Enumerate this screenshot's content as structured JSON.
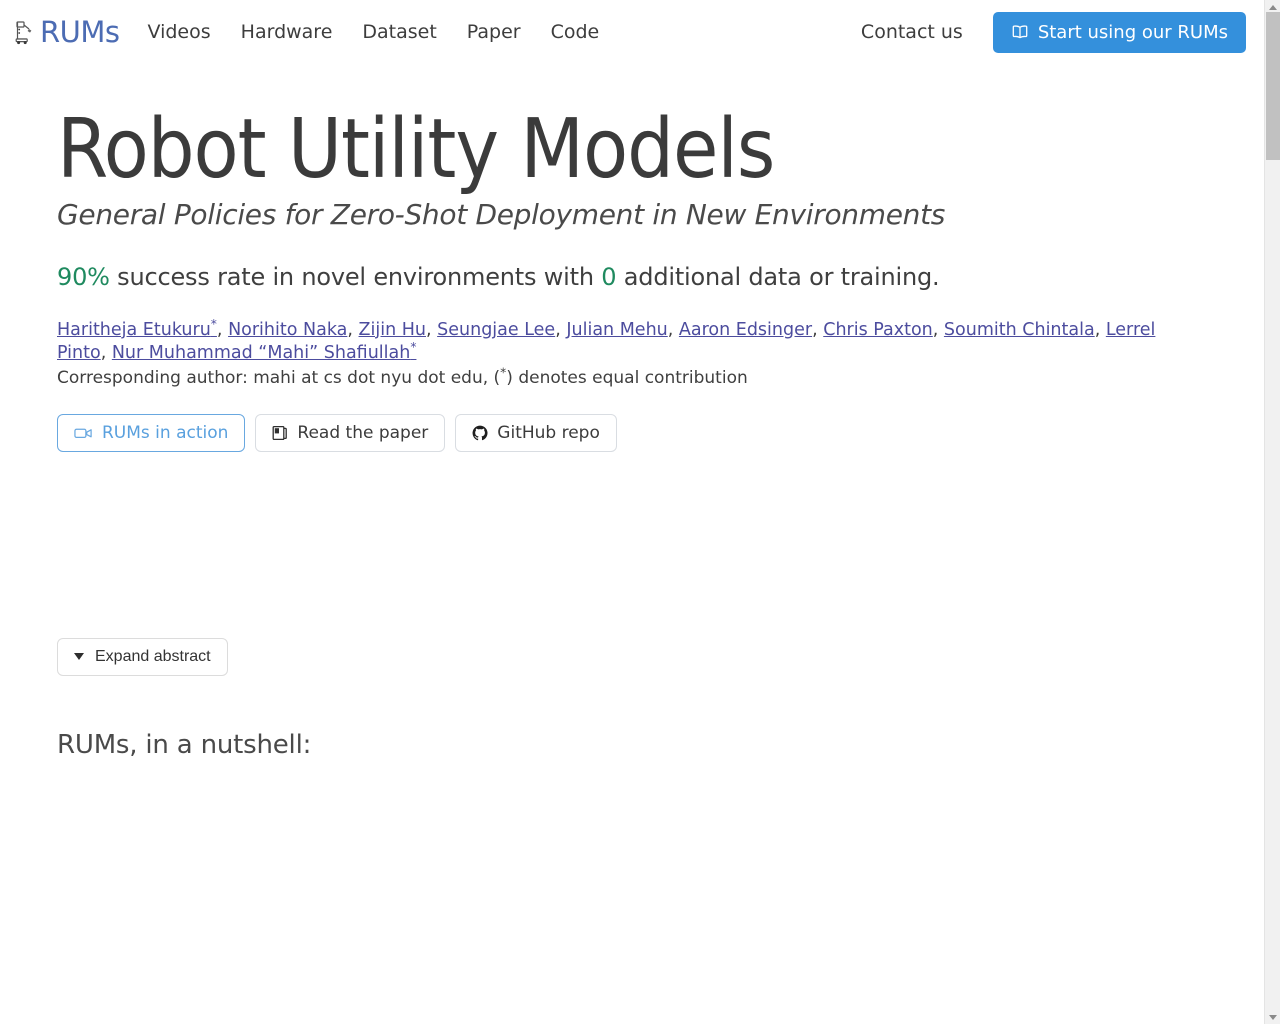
{
  "navbar": {
    "brand_label": "RUMs",
    "brand_icon": "robot-icon",
    "links": [
      {
        "label": "Videos"
      },
      {
        "label": "Hardware"
      },
      {
        "label": "Dataset"
      },
      {
        "label": "Paper"
      },
      {
        "label": "Code"
      }
    ],
    "contact_label": "Contact us",
    "cta": {
      "label": "Start using our RUMs",
      "icon": "book-open-icon",
      "background": "#3490dc",
      "color": "#ffffff"
    }
  },
  "hero": {
    "title": "Robot Utility Models",
    "subtitle": "General Policies for Zero-Shot Deployment in New Environments",
    "tagline": {
      "stat_rate": "90%",
      "middle": " success rate in novel environments with ",
      "stat_data": "0",
      "end": " additional data or training.",
      "accent_color": "#1f8a5f"
    }
  },
  "authors": {
    "list": [
      {
        "name": "Haritheja Etukuru",
        "star": "*"
      },
      {
        "name": "Norihito Naka",
        "star": ""
      },
      {
        "name": "Zijin Hu",
        "star": ""
      },
      {
        "name": "Seungjae Lee",
        "star": ""
      },
      {
        "name": "Julian Mehu",
        "star": ""
      },
      {
        "name": "Aaron Edsinger",
        "star": ""
      },
      {
        "name": "Chris Paxton",
        "star": ""
      },
      {
        "name": "Soumith Chintala",
        "star": ""
      },
      {
        "name": "Lerrel Pinto",
        "star": ""
      },
      {
        "name": "Nur Muhammad “Mahi” Shafiullah",
        "star": "*"
      }
    ],
    "separator": ", ",
    "corresponding_prefix": "Corresponding author: mahi at cs dot nyu dot edu, (",
    "corresponding_star": "*",
    "corresponding_suffix": ") denotes equal contribution"
  },
  "link_buttons": [
    {
      "label": "RUMs in action",
      "icon": "video-camera-icon",
      "active": true
    },
    {
      "label": "Read the paper",
      "icon": "journal-icon",
      "active": false
    },
    {
      "label": "GitHub repo",
      "icon": "github-icon",
      "active": false
    }
  ],
  "abstract": {
    "expand_label": "Expand abstract",
    "caret_icon": "caret-down-icon"
  },
  "nutshell": {
    "heading": "RUMs, in a nutshell:"
  },
  "scrollbar": {
    "up_icon": "scroll-up-arrow-icon",
    "down_icon": "scroll-down-arrow-icon"
  }
}
